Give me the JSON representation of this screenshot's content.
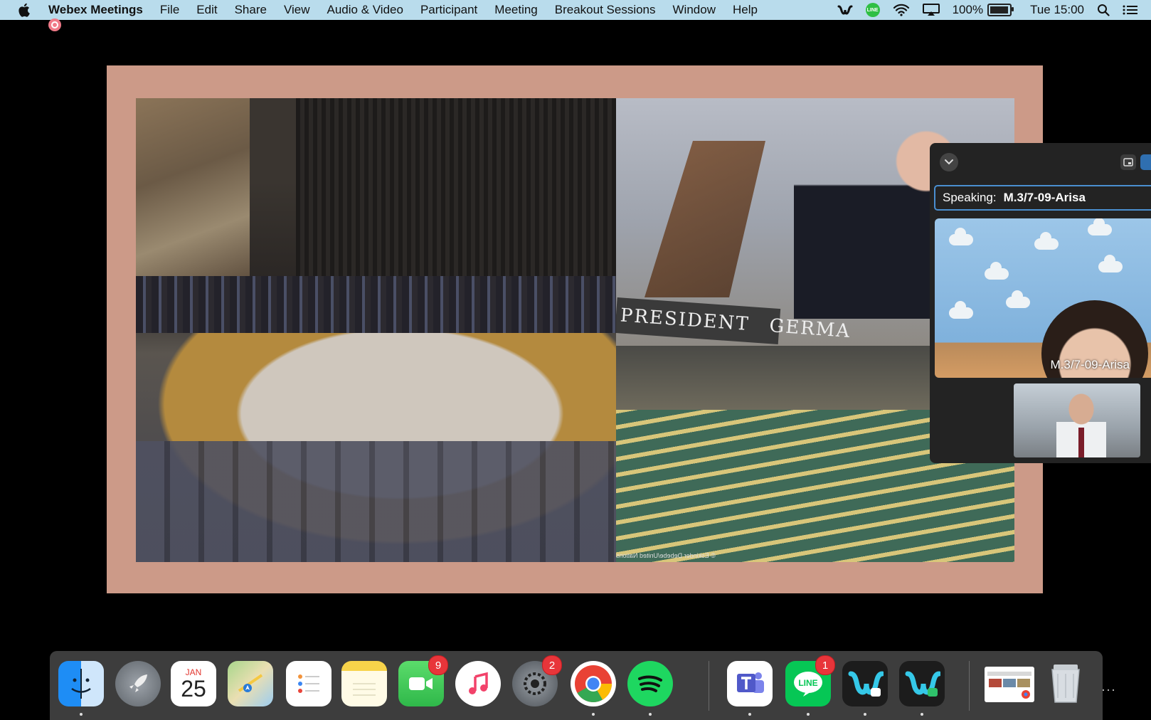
{
  "menubar": {
    "app_name": "Webex Meetings",
    "menus": [
      "File",
      "Edit",
      "Share",
      "View",
      "Audio & Video",
      "Participant",
      "Meeting",
      "Breakout Sessions",
      "Window",
      "Help"
    ],
    "battery": "100%",
    "clock": "Tue 15:00",
    "line_label": "LINE"
  },
  "slide": {
    "plate_text": "PRESIDENT",
    "plate_text_2": "GERMA",
    "credit": "© Eskinder Debebe/United Nations"
  },
  "panel": {
    "speaking_label": "Speaking:",
    "speaking_name": "M.3/7-09-Arisa",
    "main_tile_name": "M.3/7-09-Arisa"
  },
  "dock": {
    "calendar_month": "JAN",
    "calendar_day": "25",
    "facetime_badge": "9",
    "settings_badge": "2",
    "line_badge": "1",
    "line_label": "LINE",
    "more": "···"
  },
  "colors": {
    "menubar": "#b9dcec",
    "slide_frame": "#cc9a88",
    "panel": "#232323",
    "speaking_border": "#4a8fd0",
    "badge": "#e8353a"
  }
}
